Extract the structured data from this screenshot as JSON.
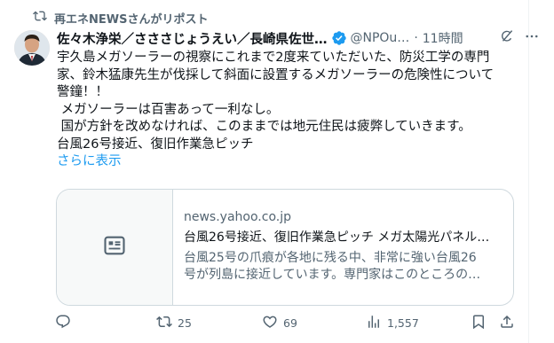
{
  "repost": {
    "label": "再エネNEWSさんがリポスト",
    "icon": "repost-icon"
  },
  "post": {
    "author": {
      "display_name": "佐々木浄栄／さささじょうえい／長崎県佐世…",
      "handle": "@NPOu…",
      "verified_color": "#1d9bf0"
    },
    "separator": "·",
    "time": "11時間",
    "text_lines": [
      "宇久島メガソーラーの視察にこれまで2度来ていただいた、防災工学の専門",
      "家、鈴木猛康先生が伐採して斜面に設置するメガソーラーの危険性について",
      "警鐘！！",
      " メガソーラーは百害あって一利なし。",
      " 国が方針を改めなければ、このままでは地元住民は疲弊していきます。",
      "台風26号接近、復旧作業急ピッチ"
    ],
    "show_more": "さらに表示",
    "card": {
      "domain": "news.yahoo.co.jp",
      "title": "台風26号接近、復旧作業急ピッチ メガ太陽光パネル…",
      "description_lines": [
        "台風25号の爪痕が各地に残る中、非常に強い台風26",
        "号が列島に接近しています。専門家はこのところの…"
      ]
    },
    "actions": {
      "reply_count": "",
      "repost_count": "25",
      "like_count": "69",
      "view_count": "1,557"
    }
  },
  "colors": {
    "accent": "#1d9bf0",
    "secondary_text": "#536471",
    "primary_text": "#0f1419",
    "border": "#cfd9de"
  }
}
